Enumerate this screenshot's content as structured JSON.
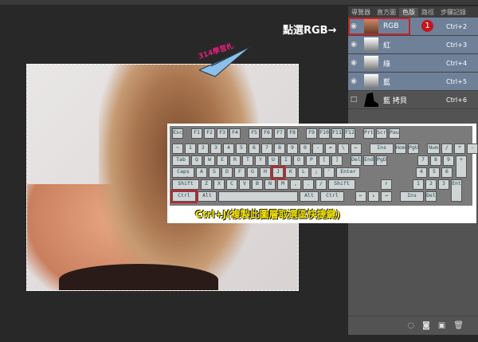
{
  "annotation": "點選RGB→",
  "watermark": "314學習札",
  "panel": {
    "tabs": [
      "導覽器",
      "直方圖",
      "色版",
      "路徑",
      "步驟記錄"
    ],
    "active_tab": 2,
    "channels": [
      {
        "name": "RGB",
        "shortcut": "Ctrl+2",
        "visible": true,
        "selected": true
      },
      {
        "name": "紅",
        "shortcut": "Ctrl+3",
        "visible": true,
        "selected": true
      },
      {
        "name": "綠",
        "shortcut": "Ctrl+4",
        "visible": true,
        "selected": true
      },
      {
        "name": "藍",
        "shortcut": "Ctrl+5",
        "visible": true,
        "selected": true
      },
      {
        "name": "藍 拷貝",
        "shortcut": "Ctrl+6",
        "visible": false,
        "selected": false
      }
    ],
    "badge": "1",
    "footer_icons": [
      "load-selection-icon",
      "save-selection-icon",
      "new-channel-icon",
      "trash-icon"
    ]
  },
  "keyboard": {
    "caption": "Ctrl+J(複製此圖層取選區快捷鍵)",
    "rows": [
      [
        "Esc",
        "F1",
        "F2",
        "F3",
        "F4",
        "F5",
        "F6",
        "F7",
        "F8",
        "F9",
        "F10",
        "F11",
        "F12",
        "PrtSc",
        "ScrLk",
        "Pause"
      ],
      [
        "~",
        "1",
        "2",
        "3",
        "4",
        "5",
        "6",
        "7",
        "8",
        "9",
        "0",
        "-",
        "=",
        "\\",
        "←",
        "Ins",
        "Home",
        "PgUp",
        "Num",
        "/",
        "*",
        "-"
      ],
      [
        "Tab",
        "Q",
        "W",
        "E",
        "R",
        "T",
        "Y",
        "U",
        "I",
        "O",
        "P",
        "[",
        "]",
        "Del",
        "End",
        "PgDn",
        "7",
        "8",
        "9",
        "+"
      ],
      [
        "Caps Lock",
        "A",
        "S",
        "D",
        "F",
        "G",
        "H",
        "J",
        "K",
        "L",
        ";",
        "'",
        "Enter",
        "4",
        "5",
        "6"
      ],
      [
        "Shift",
        "Z",
        "X",
        "C",
        "V",
        "B",
        "N",
        "M",
        ",",
        ".",
        "/",
        "Shift",
        "↑",
        "1",
        "2",
        "3",
        "Ent"
      ],
      [
        "Ctrl",
        "Alt",
        "",
        "Alt",
        "Ctrl",
        "←",
        "↓",
        "→",
        "Ins",
        "Del"
      ]
    ],
    "highlighted": [
      "J",
      "Ctrl"
    ]
  }
}
